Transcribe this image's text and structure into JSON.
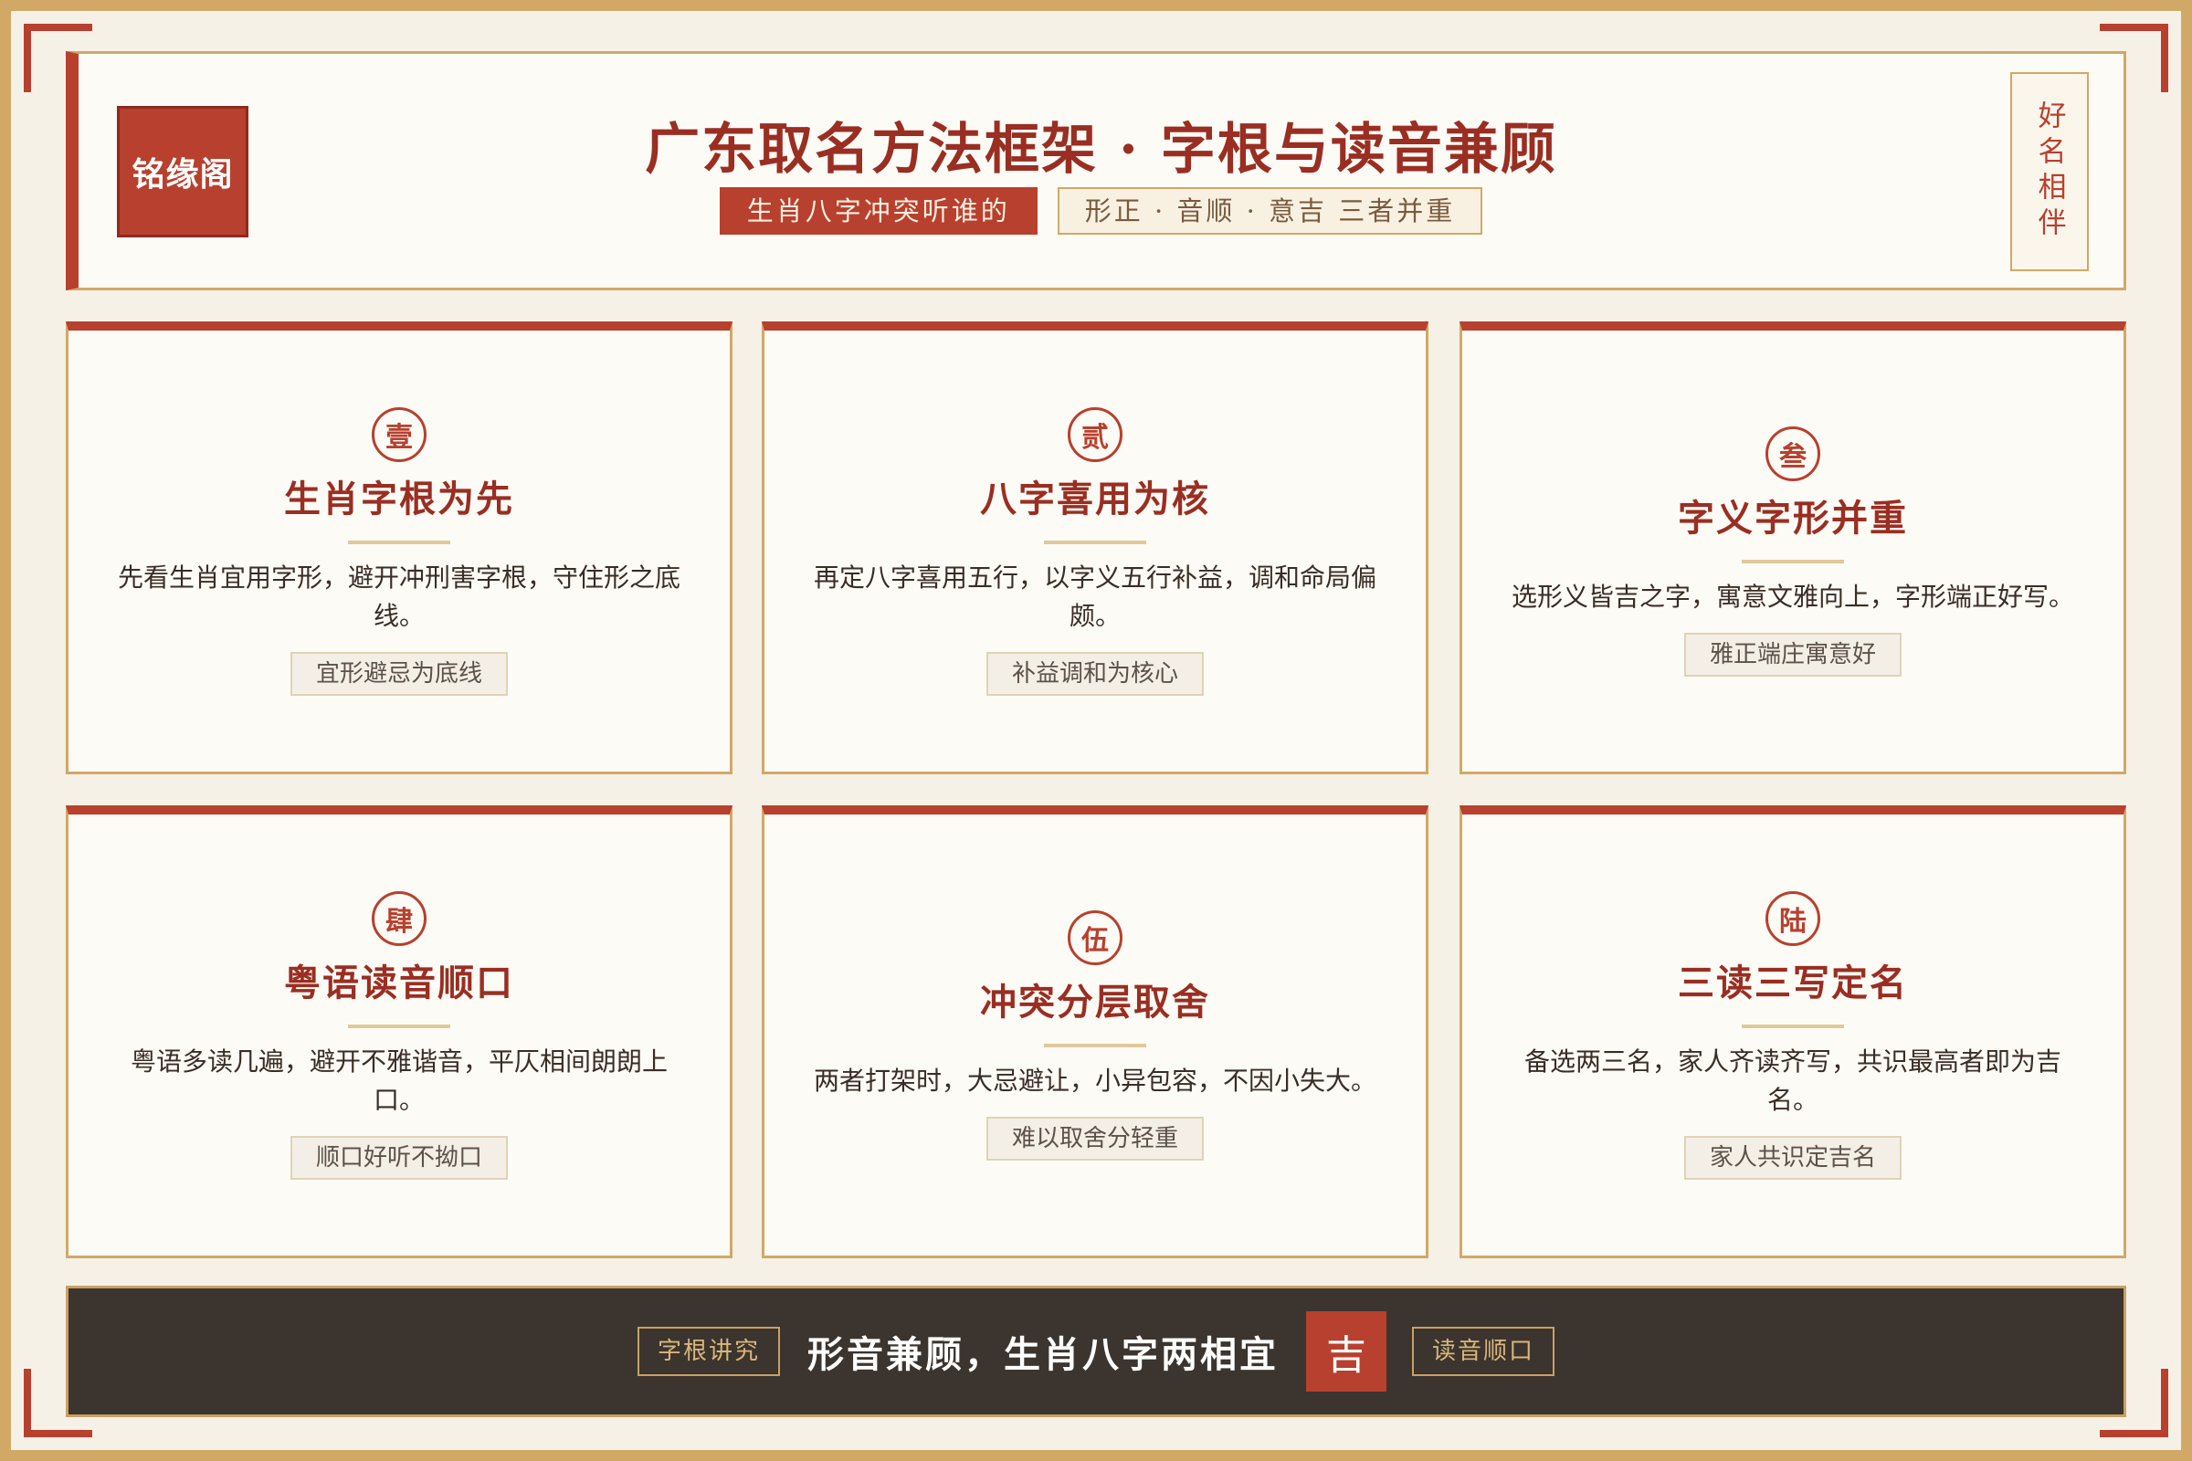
{
  "header": {
    "logo": "铭缘阁",
    "title": "广东取名方法框架 · 字根与读音兼顾",
    "tag_primary": "生肖八字冲突听谁的",
    "tag_secondary": "形正 · 音顺 · 意吉 三者并重",
    "vertical_tag": "好名相伴"
  },
  "cards": [
    {
      "seal": "壹",
      "title": "生肖字根为先",
      "desc": "先看生肖宜用字形，避开冲刑害字根，守住形之底线。",
      "tag": "宜形避忌为底线"
    },
    {
      "seal": "贰",
      "title": "八字喜用为核",
      "desc": "再定八字喜用五行，以字义五行补益，调和命局偏颇。",
      "tag": "补益调和为核心"
    },
    {
      "seal": "叁",
      "title": "字义字形并重",
      "desc": "选形义皆吉之字，寓意文雅向上，字形端正好写。",
      "tag": "雅正端庄寓意好"
    },
    {
      "seal": "肆",
      "title": "粤语读音顺口",
      "desc": "粤语多读几遍，避开不雅谐音，平仄相间朗朗上口。",
      "tag": "顺口好听不拗口"
    },
    {
      "seal": "伍",
      "title": "冲突分层取舍",
      "desc": "两者打架时，大忌避让，小异包容，不因小失大。",
      "tag": "难以取舍分轻重"
    },
    {
      "seal": "陆",
      "title": "三读三写定名",
      "desc": "备选两三名，家人齐读齐写，共识最高者即为吉名。",
      "tag": "家人共识定吉名"
    }
  ],
  "footer": {
    "left_tag": "字根讲究",
    "text": "形音兼顾，生肖八字两相宜",
    "seal": "吉",
    "right_tag": "读音顺口"
  },
  "colors": {
    "accent_red": "#b8402e",
    "gold": "#d2a867",
    "footer_bg": "#3c342e"
  }
}
